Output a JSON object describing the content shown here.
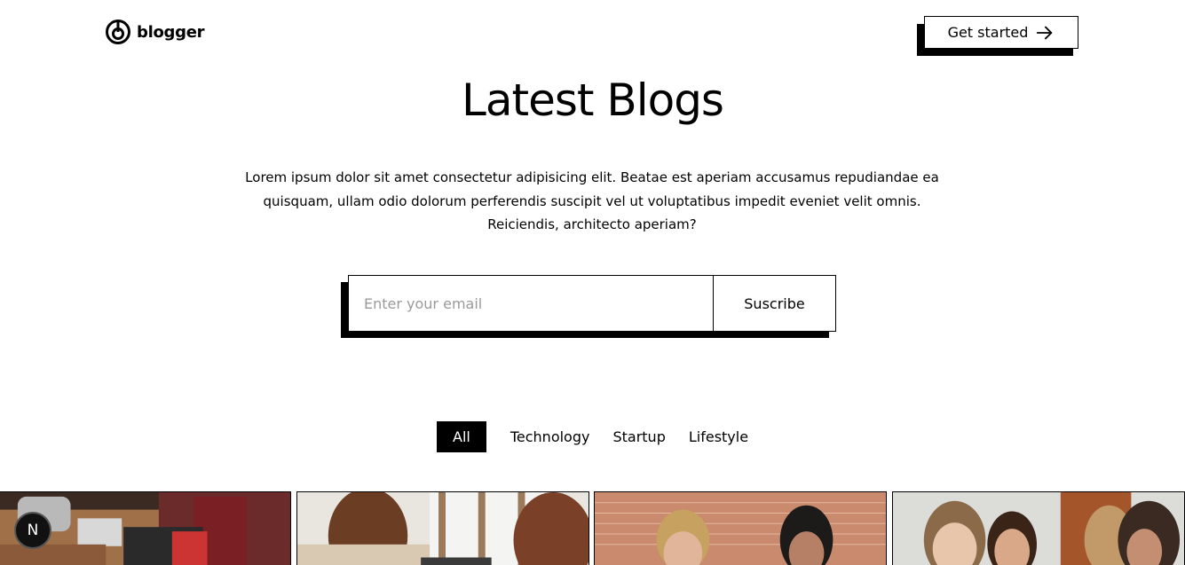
{
  "header": {
    "logo_text": "blogger",
    "cta_label": "Get started"
  },
  "hero": {
    "title": "Latest Blogs",
    "description": "Lorem ipsum dolor sit amet consectetur adipisicing elit. Beatae est aperiam accusamus repudiandae ea quisquam, ullam odio dolorum perferendis suscipit vel ut voluptatibus impedit eveniet velit omnis. Reiciendis, architecto aperiam?"
  },
  "subscribe": {
    "placeholder": "Enter your email",
    "value": "",
    "button_label": "Suscribe"
  },
  "tabs": [
    {
      "label": "All",
      "active": true
    },
    {
      "label": "Technology",
      "active": false
    },
    {
      "label": "Startup",
      "active": false
    },
    {
      "label": "Lifestyle",
      "active": false
    }
  ],
  "cards": [
    {
      "image": "people-working-on-laptops-photo"
    },
    {
      "image": "women-at-window-photo"
    },
    {
      "image": "women-meeting-brick-wall-photo"
    },
    {
      "image": "team-smiling-photo"
    }
  ],
  "dev_badge": {
    "label": "N",
    "icon": "nextjs-icon"
  },
  "colors": {
    "primary": "#000000",
    "background": "#ffffff",
    "placeholder": "#9a9a9a"
  }
}
